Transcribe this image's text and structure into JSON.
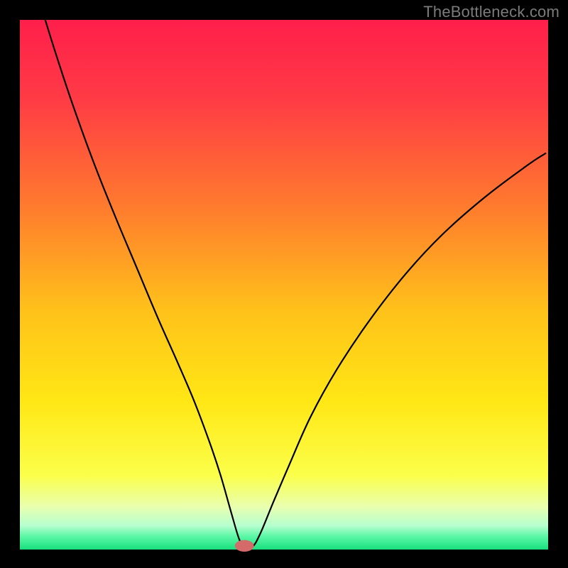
{
  "watermark": "TheBottleneck.com",
  "chart_data": {
    "type": "line",
    "title": "",
    "xlabel": "",
    "ylabel": "",
    "xlim": [
      0,
      100
    ],
    "ylim": [
      0,
      100
    ],
    "grid": false,
    "legend": false,
    "gradient_stops": [
      {
        "offset": 0.0,
        "color": "#ff1f4b"
      },
      {
        "offset": 0.15,
        "color": "#ff3b45"
      },
      {
        "offset": 0.35,
        "color": "#ff7a2e"
      },
      {
        "offset": 0.55,
        "color": "#ffc21a"
      },
      {
        "offset": 0.72,
        "color": "#ffe715"
      },
      {
        "offset": 0.86,
        "color": "#fbff4a"
      },
      {
        "offset": 0.92,
        "color": "#e8ffb0"
      },
      {
        "offset": 0.955,
        "color": "#b6ffd0"
      },
      {
        "offset": 0.975,
        "color": "#5cf7a6"
      },
      {
        "offset": 1.0,
        "color": "#18e07f"
      }
    ],
    "marker": {
      "x": 42.5,
      "y": 0.7,
      "color": "#d46a6a",
      "rx": 1.8,
      "ry": 1.1
    },
    "series": [
      {
        "name": "curve",
        "color": "#000000",
        "points": [
          {
            "x": 4.8,
            "y": 100.0
          },
          {
            "x": 7.0,
            "y": 93.0
          },
          {
            "x": 10.0,
            "y": 84.0
          },
          {
            "x": 14.0,
            "y": 73.0
          },
          {
            "x": 18.0,
            "y": 63.0
          },
          {
            "x": 22.0,
            "y": 53.5
          },
          {
            "x": 26.0,
            "y": 44.0
          },
          {
            "x": 30.0,
            "y": 35.0
          },
          {
            "x": 33.0,
            "y": 28.0
          },
          {
            "x": 36.0,
            "y": 20.0
          },
          {
            "x": 38.0,
            "y": 14.0
          },
          {
            "x": 40.0,
            "y": 7.0
          },
          {
            "x": 41.5,
            "y": 2.0
          },
          {
            "x": 42.5,
            "y": 0.5
          },
          {
            "x": 44.0,
            "y": 0.5
          },
          {
            "x": 45.5,
            "y": 3.0
          },
          {
            "x": 48.0,
            "y": 9.0
          },
          {
            "x": 51.0,
            "y": 16.0
          },
          {
            "x": 55.0,
            "y": 25.0
          },
          {
            "x": 60.0,
            "y": 34.0
          },
          {
            "x": 66.0,
            "y": 43.0
          },
          {
            "x": 73.0,
            "y": 52.0
          },
          {
            "x": 80.0,
            "y": 59.5
          },
          {
            "x": 88.0,
            "y": 66.5
          },
          {
            "x": 96.0,
            "y": 72.5
          },
          {
            "x": 99.5,
            "y": 74.8
          }
        ]
      }
    ]
  }
}
